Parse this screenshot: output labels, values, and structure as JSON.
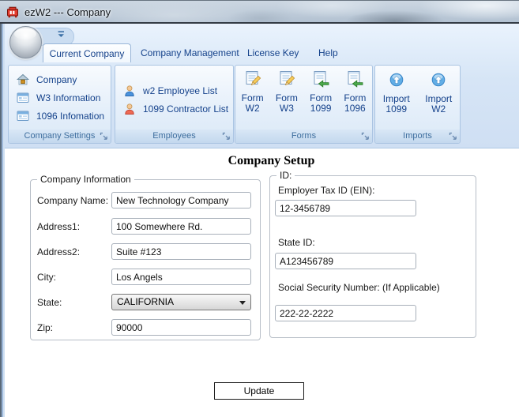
{
  "window": {
    "title": "ezW2 --- Company"
  },
  "ribbon": {
    "tabs": [
      {
        "label": "Current Company",
        "active": true
      },
      {
        "label": "Company Management",
        "active": false
      },
      {
        "label": "License Key",
        "active": false
      },
      {
        "label": "Help",
        "active": false
      }
    ],
    "groups": [
      {
        "caption": "Company Settings",
        "items": [
          {
            "icon": "house-icon",
            "label": "Company"
          },
          {
            "icon": "table-icon",
            "label": "W3 Information"
          },
          {
            "icon": "table-icon",
            "label": "1096 Infomation"
          }
        ]
      },
      {
        "caption": "Employees",
        "items": [
          {
            "icon": "person-blue-icon",
            "label": "w2 Employee List"
          },
          {
            "icon": "person-red-icon",
            "label": "1099 Contractor List"
          }
        ]
      },
      {
        "caption": "Forms",
        "buttons": [
          {
            "icon": "form-edit-icon",
            "line1": "Form",
            "line2": "W2"
          },
          {
            "icon": "form-edit-icon",
            "line1": "Form",
            "line2": "W3"
          },
          {
            "icon": "form-arrow-icon",
            "line1": "Form",
            "line2": "1099"
          },
          {
            "icon": "form-arrow-icon",
            "line1": "Form",
            "line2": "1096"
          }
        ]
      },
      {
        "caption": "Imports",
        "buttons": [
          {
            "icon": "import-icon",
            "line1": "Import",
            "line2": "1099"
          },
          {
            "icon": "import-icon",
            "line1": "Import",
            "line2": "W2"
          }
        ]
      }
    ]
  },
  "content": {
    "heading": "Company Setup",
    "company_info": {
      "legend": "Company Information",
      "fields": [
        {
          "label": "Company Name:",
          "value": "New Technology Company"
        },
        {
          "label": "Address1:",
          "value": "100 Somewhere Rd."
        },
        {
          "label": "Address2:",
          "value": "Suite #123"
        },
        {
          "label": "City:",
          "value": "Los Angels"
        },
        {
          "label": "State:",
          "value": "CALIFORNIA"
        },
        {
          "label": "Zip:",
          "value": "90000"
        }
      ]
    },
    "id_info": {
      "legend": "ID:",
      "fields": [
        {
          "label": "Employer Tax ID (EIN):",
          "value": "12-3456789"
        },
        {
          "label": "State ID:",
          "value": "A123456789"
        },
        {
          "label": "Social Security Number: (If Applicable)",
          "value": "222-22-2222"
        }
      ]
    },
    "update_label": "Update"
  },
  "colors": {
    "ribbon_text": "#15428b",
    "group_caption_text": "#3e6e9e",
    "ribbon_bg": "#d6e5f6",
    "titlebar_glass": "#bcc9d8",
    "app_icon_red": "#e23b2e"
  }
}
